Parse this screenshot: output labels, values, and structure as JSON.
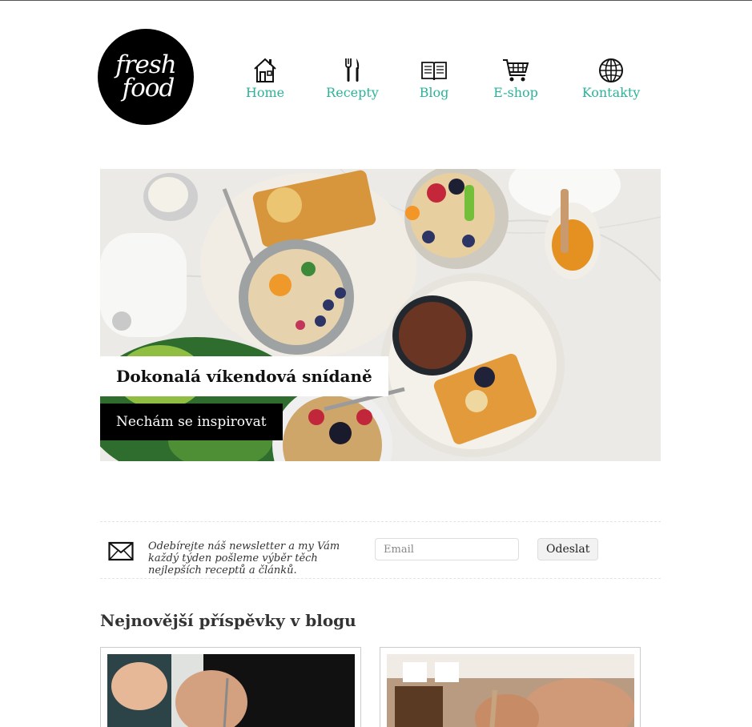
{
  "logo": {
    "line1": "fresh",
    "line2": "food"
  },
  "nav": {
    "items": [
      {
        "label": "Home",
        "icon": "home-icon"
      },
      {
        "label": "Recepty",
        "icon": "cutlery-icon"
      },
      {
        "label": "Blog",
        "icon": "book-icon"
      },
      {
        "label": "E-shop",
        "icon": "cart-icon"
      },
      {
        "label": "Kontakty",
        "icon": "globe-icon"
      }
    ],
    "accent_color": "#2bb39a"
  },
  "hero": {
    "title": "Dokonalá víkendová snídaně",
    "button_label": "Nechám se inspirovat"
  },
  "newsletter": {
    "icon": "envelope-icon",
    "text": "Odebírejte náš newsletter a my Vám každý týden pošleme výběr těch nejlepších receptů a článků.",
    "email_placeholder": "Email",
    "email_value": "",
    "submit_label": "Odeslat"
  },
  "blog": {
    "heading": "Nejnovější příspěvky v blogu"
  }
}
